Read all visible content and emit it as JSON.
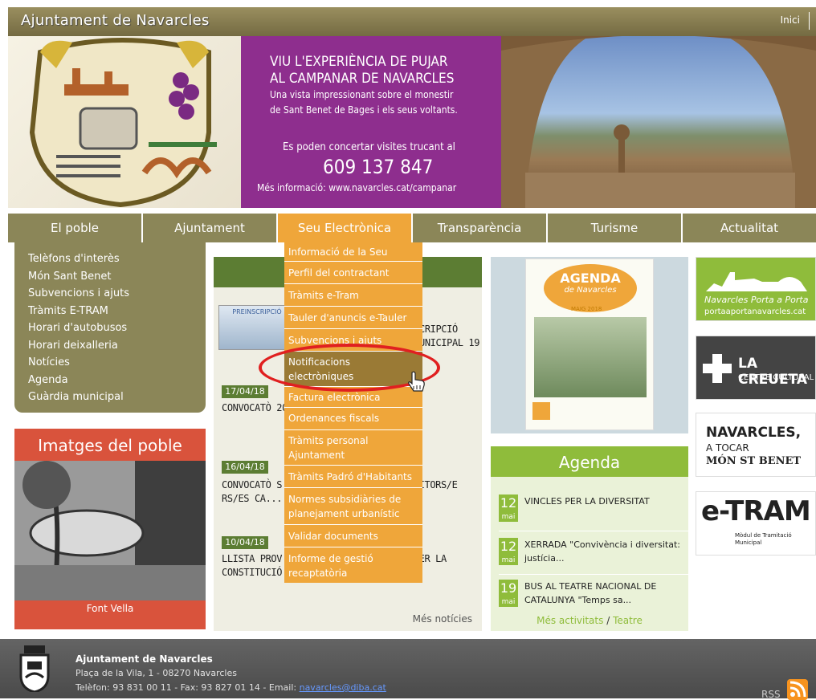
{
  "header": {
    "title": "Ajuntament de Navarcles",
    "home_link": "Inici"
  },
  "banner": {
    "promo_lines": [
      "VIU L'EXPERIÈNCIA DE PUJAR",
      "AL CAMPANAR DE NAVARCLES",
      "Una vista impressionant sobre el monestir",
      "de Sant Benet de Bages i els seus voltants.",
      "Es poden concertar visites trucant al",
      "609 137 847",
      "Més informació: www.navarcles.cat/campanar"
    ],
    "colors": {
      "promo_bg": "#8e2e8e"
    }
  },
  "nav": {
    "items": [
      "El poble",
      "Ajuntament",
      "Seu Electrònica",
      "Transparència",
      "Turisme",
      "Actualitat"
    ]
  },
  "left_menu": {
    "items": [
      "Telèfons d'interès",
      "Món Sant Benet",
      "Subvencions i ajuts",
      "Tràmits E-TRAM",
      "Horari d'autobusos",
      "Horari deixalleria",
      "Notícies",
      "Agenda",
      "Guàrdia municipal"
    ]
  },
  "gallery": {
    "title": "Imatges del poble",
    "caption": "Font Vella"
  },
  "dropdown": {
    "items": [
      "Informació de la Seu",
      "Perfil del contractant",
      "Tràmits e-Tram",
      "Tauler d'anuncis e-Tauler",
      "Subvencions i ajuts",
      "Notificacions electròniques",
      "Factura electrònica",
      "Ordenances fiscals",
      "Tràmits personal Ajuntament",
      "Tràmits Padró d'Habitants",
      "Normes subsidiàries de planejament urbanístic",
      "Validar documents",
      "Informe de gestió recaptatòria"
    ],
    "hover_index": 5
  },
  "news": {
    "thumb_text": "PREINSCRIPCIÓ",
    "items": [
      {
        "date": "",
        "text": "CRIPCIÓ UNICIPAL 19"
      },
      {
        "date": "17/04/18",
        "text": "CONVOCATÒ 2018 DE 2 PLACES DE P"
      },
      {
        "date": "16/04/18",
        "text": "CONVOCATÒ S DEL PROCÉS SEL EBALL MONITORS/E RS/ES CA..."
      },
      {
        "date": "10/04/18",
        "text": "LLISTA PROV LOSOS I COMPOSICIÓ TIU PER LA CONSTITUCIÓ D'UNA BORSA DE TREBA..."
      }
    ],
    "more": "Més notícies"
  },
  "poster": {
    "title": "AGENDA",
    "subtitle": "de Navarcles",
    "month": "MAIG 2018"
  },
  "agenda": {
    "title": "Agenda",
    "events": [
      {
        "day": "12",
        "month": "mai",
        "title": "VINCLES PER LA DIVERSITAT"
      },
      {
        "day": "12",
        "month": "mai",
        "title": "XERRADA \"Convivència i diversitat: justícia..."
      },
      {
        "day": "19",
        "month": "mai",
        "title": "BUS AL TEATRE NACIONAL DE CATALUNYA \"Temps sa..."
      }
    ],
    "more": "Més activitats",
    "separator": "/",
    "theatre": "Teatre"
  },
  "side_banners": [
    {
      "title": "Navarcles Porta a Porta",
      "url": "portaaportanavarcles.cat"
    },
    {
      "title": "LA CREUETA",
      "subtitle": "CENTRE CULTURAL"
    },
    {
      "title": "NAVARCLES,",
      "subtitle": "A TOCAR",
      "extra": "MÓN ST BENET"
    },
    {
      "title": "e-TRAM",
      "subtitle": "Mòdul de Tramitació Municipal"
    }
  ],
  "footer": {
    "name": "Ajuntament de Navarcles",
    "address": "Plaça de la Vila, 1 - 08270 Navarcles",
    "phone_prefix": "Telèfon: 93 831 00 11 - Fax: 93 827 01 14 - Email: ",
    "email": "navarcles@diba.cat",
    "rss": "RSS"
  }
}
